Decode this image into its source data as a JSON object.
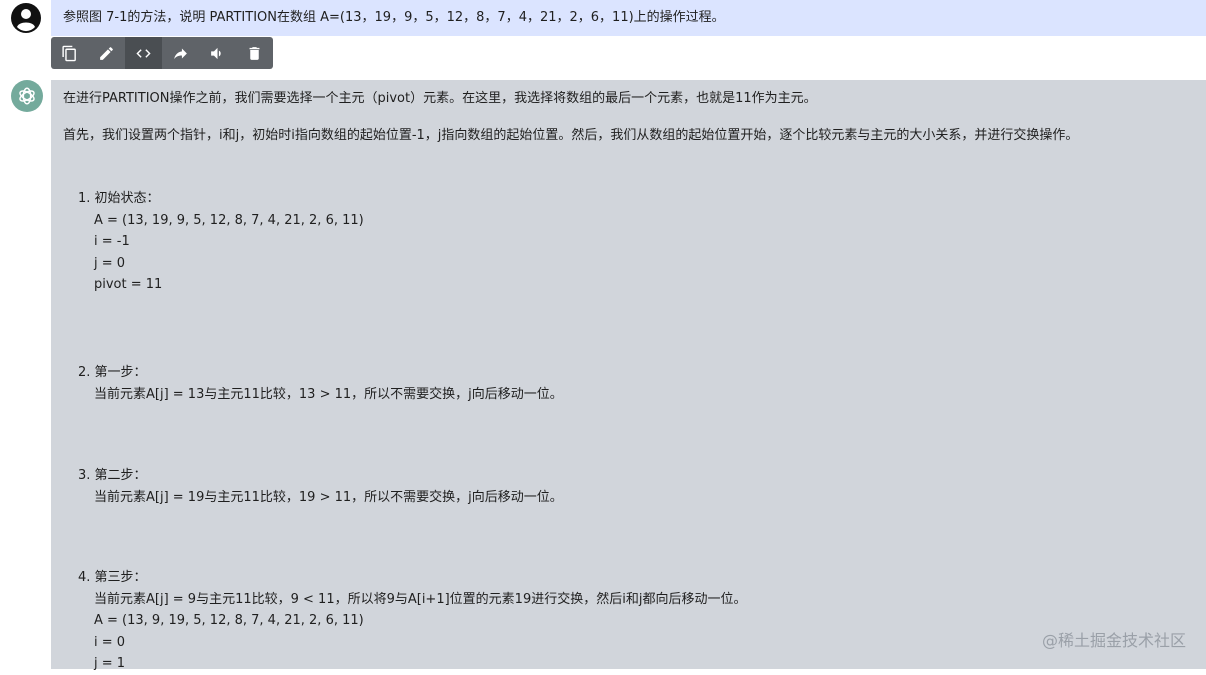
{
  "question": {
    "text": "参照图 7-1的方法，说明 PARTITION在数组 A=(13，19，9，5，12，8，7，4，21，2，6，11)上的操作过程。"
  },
  "toolbar": {
    "icons": [
      "copy-icon",
      "edit-icon",
      "code-icon",
      "share-icon",
      "speaker-icon",
      "delete-icon"
    ]
  },
  "answer": {
    "intro": "在进行PARTITION操作之前，我们需要选择一个主元（pivot）元素。在这里，我选择将数组的最后一个元素，也就是11作为主元。",
    "setup": "首先，我们设置两个指针，i和j，初始时i指向数组的起始位置-1，j指向数组的起始位置。然后，我们从数组的起始位置开始，逐个比较元素与主元的大小关系，并进行交换操作。",
    "steps": [
      {
        "title": "1. 初始状态：",
        "lines": [
          "A = (13, 19, 9, 5, 12, 8, 7, 4, 21, 2, 6, 11)",
          "i = -1",
          "j = 0",
          "pivot = 11"
        ]
      },
      {
        "title": "2. 第一步：",
        "lines": [
          "当前元素A[j] = 13与主元11比较，13 > 11，所以不需要交换，j向后移动一位。"
        ]
      },
      {
        "title": "3. 第二步：",
        "lines": [
          "当前元素A[j] = 19与主元11比较，19 > 11，所以不需要交换，j向后移动一位。"
        ]
      },
      {
        "title": "4. 第三步：",
        "lines": [
          "当前元素A[j] = 9与主元11比较，9 < 11，所以将9与A[i+1]位置的元素19进行交换，然后i和j都向后移动一位。",
          "A = (13, 9, 19, 5, 12, 8, 7, 4, 21, 2, 6, 11)",
          "i = 0",
          "j = 1"
        ]
      }
    ]
  },
  "watermark": "@稀土掘金技术社区",
  "colors": {
    "question_bg": "#dbe4ff",
    "answer_bg": "#d1d5db",
    "toolbar_bg": "#5f6368",
    "bot_avatar": "#74aa9c"
  }
}
